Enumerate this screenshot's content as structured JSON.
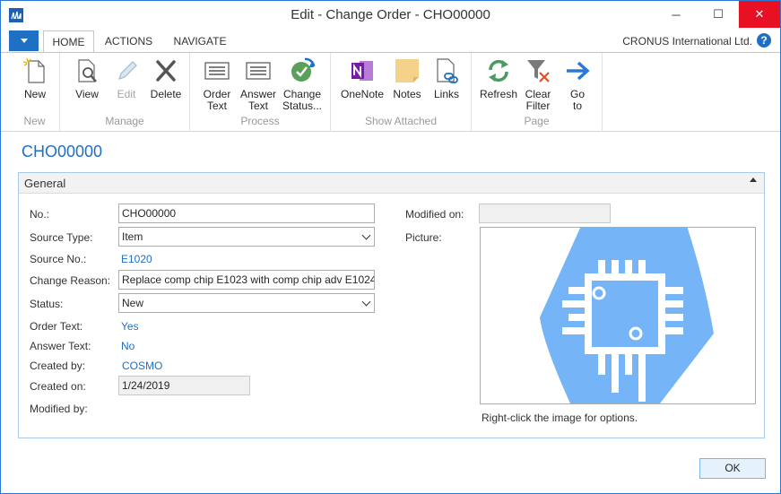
{
  "window": {
    "title": "Edit - Change Order - CHO00000",
    "minimize": "─",
    "maximize": "☐",
    "close": "✕"
  },
  "tabs": {
    "home": "HOME",
    "actions": "ACTIONS",
    "navigate": "NAVIGATE"
  },
  "company": "CRONUS International Ltd.",
  "help": "?",
  "ribbon": {
    "groups": {
      "new": "New",
      "manage": "Manage",
      "process": "Process",
      "show_attached": "Show Attached",
      "page": "Page"
    },
    "buttons": {
      "new": "New",
      "view": "View",
      "edit": "Edit",
      "delete": "Delete",
      "order_text_1": "Order",
      "order_text_2": "Text",
      "answer_text_1": "Answer",
      "answer_text_2": "Text",
      "change_status_1": "Change",
      "change_status_2": "Status...",
      "onenote": "OneNote",
      "notes": "Notes",
      "links": "Links",
      "refresh": "Refresh",
      "clear_filter_1": "Clear",
      "clear_filter_2": "Filter",
      "goto_1": "Go",
      "goto_2": "to"
    },
    "icons": [
      "new-icon",
      "view-icon",
      "edit-icon",
      "delete-icon",
      "order-text-icon",
      "answer-text-icon",
      "change-status-icon",
      "onenote-icon",
      "notes-icon",
      "links-icon",
      "refresh-icon",
      "clear-filter-icon",
      "goto-icon"
    ]
  },
  "page_title": "CHO00000",
  "fasttab": {
    "title": "General"
  },
  "fields": {
    "no_label": "No.:",
    "no_value": "CHO00000",
    "source_type_label": "Source Type:",
    "source_type_value": "Item",
    "source_no_label": "Source No.:",
    "source_no_value": "E1020",
    "change_reason_label": "Change Reason:",
    "change_reason_value": "Replace comp chip E1023 with comp chip adv E1024",
    "status_label": "Status:",
    "status_value": "New",
    "order_text_label": "Order Text:",
    "order_text_value": "Yes",
    "answer_text_label": "Answer Text:",
    "answer_text_value": "No",
    "created_by_label": "Created by:",
    "created_by_value": "COSMO",
    "created_on_label": "Created on:",
    "created_on_value": "1/24/2019",
    "modified_by_label": "Modified by:",
    "modified_on_label": "Modified on:",
    "modified_on_value": "",
    "picture_label": "Picture:",
    "picture_hint": "Right-click the image for options."
  },
  "ok_button": "OK",
  "colors": {
    "accent": "#1f6fc5",
    "picture_blue": "#74b4f7",
    "close_red": "#e81123"
  }
}
